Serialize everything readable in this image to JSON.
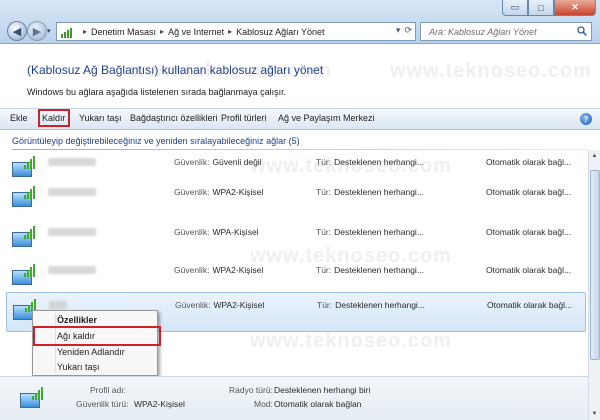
{
  "window": {
    "buttons": [
      "▭",
      "□",
      "✕"
    ]
  },
  "nav": {
    "back_glyph": "◀",
    "forward_glyph": "▶",
    "dropdown_glyph": "▾"
  },
  "address": {
    "crumbs": [
      "Denetim Masası",
      "Ağ ve Internet",
      "Kablosuz Ağları Yönet"
    ],
    "separator": "▸",
    "dropdown_glyph": "▾",
    "refresh_glyph": "⟳"
  },
  "search": {
    "placeholder": "Ara: Kablosuz Ağları Yönet"
  },
  "page": {
    "heading": "(Kablosuz Ağ Bağlantısı) kullanan kablosuz ağları yönet",
    "subtext": "Windows bu ağlara aşağıda listelenen sırada bağlanmaya çalışır."
  },
  "toolbar": {
    "items": [
      "Ekle",
      "Kaldır",
      "Yukarı taşı",
      "Bağdaştırıcı özellikleri",
      "Profil türleri",
      "Ağ ve Paylaşım Merkezi"
    ],
    "help_label": "?"
  },
  "group": {
    "header": "Görüntüleyip değiştirebileceğiniz ve yeniden sıralayabileceğiniz ağlar (5)"
  },
  "networks": [
    {
      "security_label": "Güvenlik:",
      "security": "Güvenli değil",
      "type_label": "Tür:",
      "type": "Desteklenen herhangi...",
      "mode": "Otomatik olarak bağl..."
    },
    {
      "security_label": "Güvenlik:",
      "security": "WPA2-Kişisel",
      "type_label": "Tür:",
      "type": "Desteklenen herhangi...",
      "mode": "Otomatik olarak bağl..."
    },
    {
      "security_label": "Güvenlik:",
      "security": "WPA-Kişisel",
      "type_label": "Tür:",
      "type": "Desteklenen herhangi...",
      "mode": "Otomatik olarak bağl..."
    },
    {
      "security_label": "Güvenlik:",
      "security": "WPA2-Kişisel",
      "type_label": "Tür:",
      "type": "Desteklenen herhangi...",
      "mode": "Otomatik olarak bağl..."
    },
    {
      "security_label": "Güvenlik:",
      "security": "WPA2-Kişisel",
      "type_label": "Tür:",
      "type": "Desteklenen herhangi...",
      "mode": "Otomatik olarak bağl..."
    }
  ],
  "context_menu": {
    "items": [
      "Özellikler",
      "Ağı kaldır",
      "Yeniden Adlandır",
      "Yukarı taşı"
    ]
  },
  "details": {
    "profile_label": "Profil adı:",
    "security_label": "Güvenlik türü:",
    "security_value": "WPA2-Kişisel",
    "radio_label": "Radyo türü:",
    "radio_value": "Desteklenen herhangi biri",
    "mode_label": "Mod:",
    "mode_value": "Otomatik olarak bağlan"
  },
  "watermark": {
    "text": "www.teknoseo.com"
  },
  "colors": {
    "accent": "#1e3f8f",
    "highlight": "#d2202a",
    "signal": "#3bad2c"
  }
}
